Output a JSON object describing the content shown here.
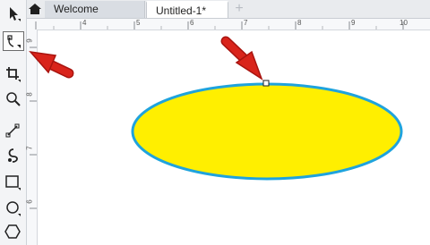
{
  "tabs": [
    {
      "label": "Welcome Screen"
    },
    {
      "label": "Untitled-1*"
    }
  ],
  "add_tab_label": "+",
  "tools": [
    "pick-tool",
    "shape-tool",
    "crop-tool",
    "zoom-tool",
    "freehand-tool",
    "artistic-media-tool",
    "rectangle-tool",
    "ellipse-tool",
    "polygon-tool"
  ],
  "ruler": {
    "h_labels": [
      "4",
      "5",
      "6",
      "7",
      "8",
      "9",
      "10"
    ],
    "v_labels": [
      "6",
      "7",
      "8",
      "9"
    ]
  },
  "colors": {
    "ellipse_fill": "#ffef00",
    "ellipse_outline": "#1fa3dd",
    "arrow": "#d9241b",
    "tab_bar": "#e9ebee"
  }
}
